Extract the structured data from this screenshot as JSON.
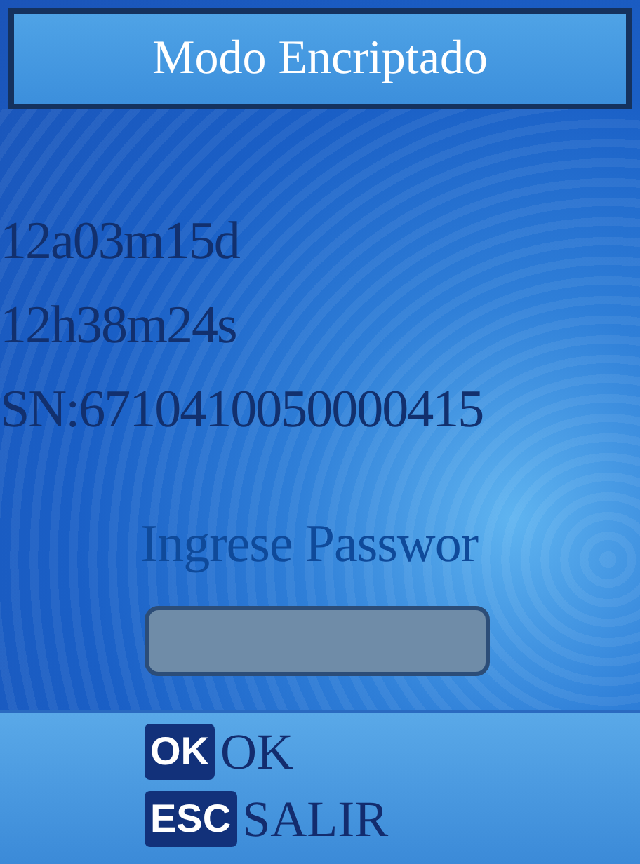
{
  "title": "Modo Encriptado",
  "info_lines": [
    "12a03m15d",
    "12h38m24s",
    "SN:6710410050000415"
  ],
  "prompt": "Ingrese Passwor",
  "softkeys": [
    {
      "key": "OK",
      "label": "OK"
    },
    {
      "key": "ESC",
      "label": "SALIR"
    }
  ]
}
